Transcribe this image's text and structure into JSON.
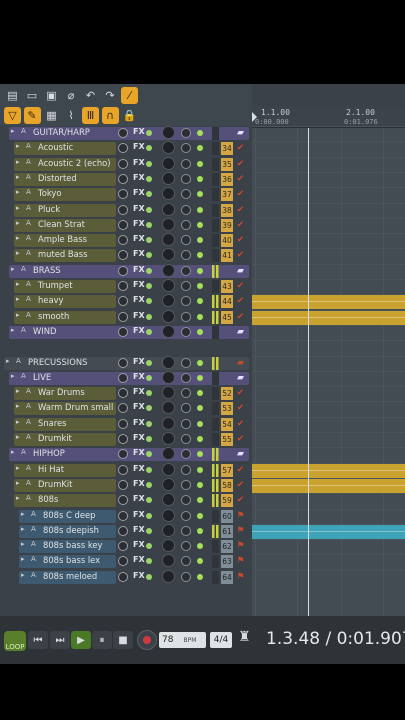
{
  "toolbar": {
    "row1": [
      {
        "name": "new-file-icon",
        "glyph": "▤"
      },
      {
        "name": "open-folder-icon",
        "glyph": "▭"
      },
      {
        "name": "save-icon",
        "glyph": "▣"
      },
      {
        "name": "magnet-icon",
        "glyph": "⌀"
      },
      {
        "name": "undo-icon",
        "glyph": "↶"
      },
      {
        "name": "redo-icon",
        "glyph": "↷"
      },
      {
        "name": "mute-icon",
        "glyph": "⁄"
      }
    ],
    "row2": [
      {
        "name": "draw-tool-icon",
        "glyph": "▽"
      },
      {
        "name": "pencil-tool-icon",
        "glyph": "✎"
      },
      {
        "name": "grid-icon",
        "glyph": "▦"
      },
      {
        "name": "link-icon",
        "glyph": "⌇"
      },
      {
        "name": "bars-icon",
        "glyph": "Ⅲ"
      },
      {
        "name": "magnet-snap-icon",
        "glyph": "∩"
      },
      {
        "name": "lock-icon",
        "glyph": "🔒"
      }
    ]
  },
  "channels": [
    {
      "label": "GUITAR/HARP",
      "type": "folder-purple",
      "indent": 1,
      "num": "",
      "icon": ""
    },
    {
      "label": "Acoustic",
      "type": "inst",
      "indent": 2,
      "num": "34",
      "meter": false
    },
    {
      "label": "Acoustic 2 (echo)",
      "type": "inst",
      "indent": 2,
      "num": "35",
      "meter": false
    },
    {
      "label": "Distorted",
      "type": "inst",
      "indent": 2,
      "num": "36",
      "meter": false
    },
    {
      "label": "Tokyo",
      "type": "inst",
      "indent": 2,
      "num": "37",
      "meter": false
    },
    {
      "label": "Pluck",
      "type": "inst",
      "indent": 2,
      "num": "38",
      "meter": false
    },
    {
      "label": "Clean Strat",
      "type": "inst",
      "indent": 2,
      "num": "39",
      "meter": false
    },
    {
      "label": "Ample Bass",
      "type": "inst",
      "indent": 2,
      "num": "40",
      "meter": false
    },
    {
      "label": "muted Bass",
      "type": "inst",
      "indent": 2,
      "num": "41",
      "meter": false
    },
    {
      "label": "BRASS",
      "type": "folder-purple",
      "indent": 1,
      "num": "",
      "meter": true
    },
    {
      "label": "Trumpet",
      "type": "inst",
      "indent": 2,
      "num": "43",
      "meter": false
    },
    {
      "label": "heavy",
      "type": "inst",
      "indent": 2,
      "num": "44",
      "meter": true
    },
    {
      "label": "smooth",
      "type": "inst",
      "indent": 2,
      "num": "45",
      "meter": true
    },
    {
      "label": "WIND",
      "type": "folder-purple",
      "indent": 1,
      "num": "",
      "meter": false
    },
    {
      "label": "",
      "type": "spacer"
    },
    {
      "label": "PRECUSSIONS",
      "type": "folder-grey",
      "indent": 0,
      "num": "",
      "meter": true
    },
    {
      "label": "LIVE",
      "type": "folder-purple",
      "indent": 1,
      "num": "",
      "meter": false
    },
    {
      "label": "War Drums",
      "type": "inst",
      "indent": 2,
      "num": "52",
      "meter": false
    },
    {
      "label": "Warm Drum small",
      "type": "inst",
      "indent": 2,
      "num": "53",
      "meter": false
    },
    {
      "label": "Snares",
      "type": "inst",
      "indent": 2,
      "num": "54",
      "meter": false
    },
    {
      "label": "Drumkit",
      "type": "inst",
      "indent": 2,
      "num": "55",
      "meter": false
    },
    {
      "label": "HIPHOP",
      "type": "folder-purple",
      "indent": 1,
      "num": "",
      "meter": true
    },
    {
      "label": "Hi Hat",
      "type": "inst",
      "indent": 2,
      "num": "57",
      "meter": true
    },
    {
      "label": "DrumKit",
      "type": "inst",
      "indent": 2,
      "num": "58",
      "meter": true
    },
    {
      "label": "808s",
      "type": "inst",
      "indent": 2,
      "num": "59",
      "meter": true
    },
    {
      "label": "808s C deep",
      "type": "sub",
      "indent": 3,
      "num": "60",
      "meter": false
    },
    {
      "label": "808s deepish",
      "type": "sub",
      "indent": 3,
      "num": "61",
      "meter": true
    },
    {
      "label": "808s bass key",
      "type": "sub",
      "indent": 3,
      "num": "62",
      "meter": false
    },
    {
      "label": "808s bass lex",
      "type": "sub",
      "indent": 3,
      "num": "63",
      "meter": false
    },
    {
      "label": "808s meloed",
      "type": "sub",
      "indent": 3,
      "num": "64",
      "meter": false
    }
  ],
  "playlist": {
    "ruler_bar1": "1.1.00",
    "ruler_time1": "0:00.000",
    "ruler_bar2": "2.1.00",
    "ruler_time2": "0:01.076",
    "clips": [
      {
        "row": 11,
        "color": "yellow"
      },
      {
        "row": 12,
        "color": "yellow"
      },
      {
        "row": 22,
        "color": "yellow"
      },
      {
        "row": 23,
        "color": "yellow"
      },
      {
        "row": 26,
        "color": "blue"
      }
    ]
  },
  "transport": {
    "loop_label": "LOOP",
    "bpm_value": "78",
    "bpm_unit": "BPM",
    "time_signature": "4/4",
    "time_display": "1.3.48 / 0:01.907"
  }
}
